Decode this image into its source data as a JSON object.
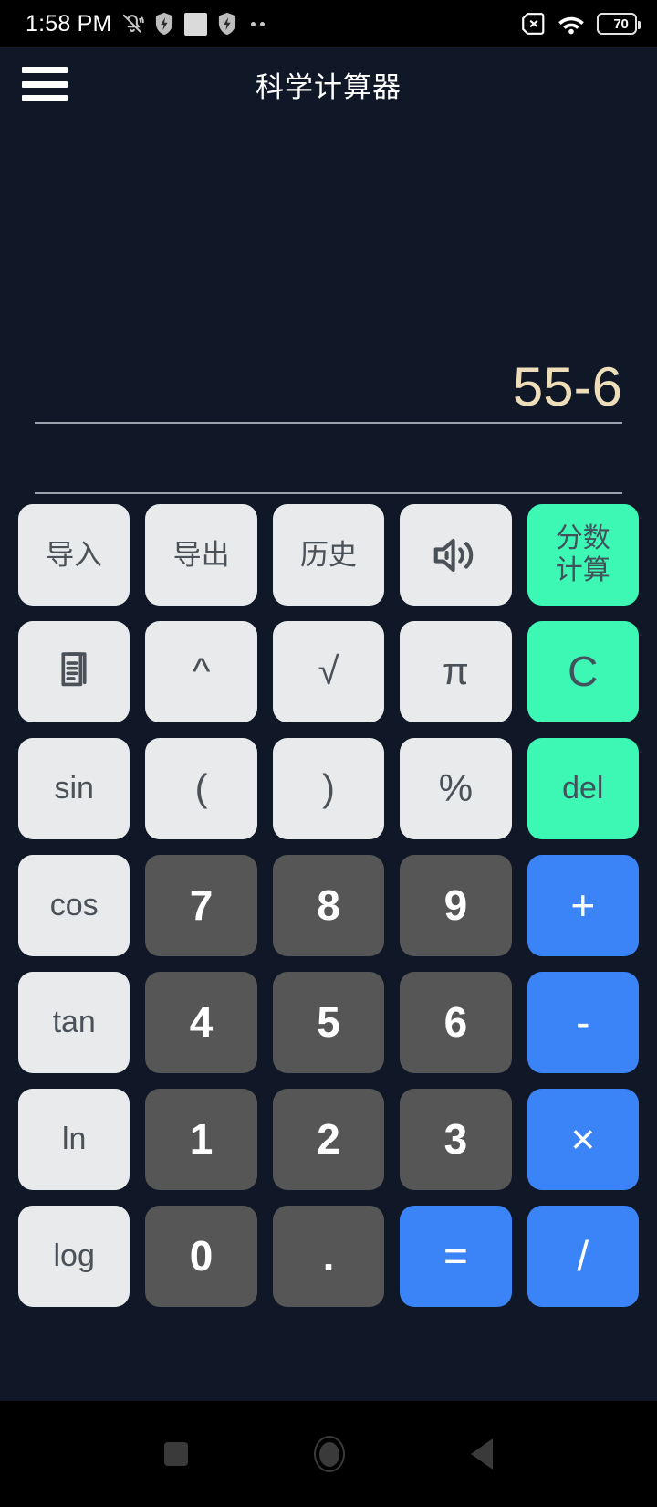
{
  "status_bar": {
    "time": "1:58 PM",
    "battery_percent": "70",
    "left_icons": [
      "bell-muted-icon",
      "shield-bolt-icon",
      "white-square-icon",
      "shield-bolt-icon",
      "two-dots-icon"
    ],
    "right_icons": [
      "sim-card-off-icon",
      "wifi-icon",
      "battery-icon"
    ]
  },
  "app_bar": {
    "menu_icon": "hamburger-menu-icon",
    "title": "科学计算器"
  },
  "display": {
    "expression": "55-6",
    "result": ""
  },
  "colors": {
    "background": "#101827",
    "status_bar": "#000000",
    "display_text": "#EEDDB9",
    "key_light": "#E8EAEC",
    "key_light_text": "#4A5158",
    "key_dark": "#565656",
    "key_dark_text": "#FFFFFF",
    "key_green": "#3DF7B5",
    "key_blue": "#3B84F7",
    "divider": "#9BA2AE"
  },
  "keypad": {
    "rows": [
      [
        {
          "label": "导入",
          "style": "light",
          "kind": "cjk",
          "name": "key-import"
        },
        {
          "label": "导出",
          "style": "light",
          "kind": "cjk",
          "name": "key-export"
        },
        {
          "label": "历史",
          "style": "light",
          "kind": "cjk",
          "name": "key-history"
        },
        {
          "label": "",
          "style": "light",
          "kind": "icon",
          "icon": "speaker-volume-icon",
          "name": "key-sound"
        },
        {
          "label": "分数\n计算",
          "style": "green",
          "kind": "cjk2",
          "name": "key-fraction-calc"
        }
      ],
      [
        {
          "label": "",
          "style": "light",
          "kind": "icon",
          "icon": "copy-documents-icon",
          "name": "key-copy"
        },
        {
          "label": "^",
          "style": "light",
          "kind": "sym",
          "name": "key-power"
        },
        {
          "label": "√",
          "style": "light",
          "kind": "sym",
          "name": "key-sqrt"
        },
        {
          "label": "π",
          "style": "light",
          "kind": "sym",
          "name": "key-pi"
        },
        {
          "label": "C",
          "style": "green",
          "kind": "c",
          "name": "key-clear"
        }
      ],
      [
        {
          "label": "sin",
          "style": "light",
          "kind": "fn",
          "name": "key-sin"
        },
        {
          "label": "(",
          "style": "light",
          "kind": "sym",
          "name": "key-paren-open"
        },
        {
          "label": ")",
          "style": "light",
          "kind": "sym",
          "name": "key-paren-close"
        },
        {
          "label": "%",
          "style": "light",
          "kind": "sym",
          "name": "key-percent"
        },
        {
          "label": "del",
          "style": "green",
          "kind": "del",
          "name": "key-delete"
        }
      ],
      [
        {
          "label": "cos",
          "style": "light",
          "kind": "fn",
          "name": "key-cos"
        },
        {
          "label": "7",
          "style": "dark",
          "kind": "num",
          "name": "key-7"
        },
        {
          "label": "8",
          "style": "dark",
          "kind": "num",
          "name": "key-8"
        },
        {
          "label": "9",
          "style": "dark",
          "kind": "num",
          "name": "key-9"
        },
        {
          "label": "+",
          "style": "blue",
          "kind": "op",
          "name": "key-plus"
        }
      ],
      [
        {
          "label": "tan",
          "style": "light",
          "kind": "fn",
          "name": "key-tan"
        },
        {
          "label": "4",
          "style": "dark",
          "kind": "num",
          "name": "key-4"
        },
        {
          "label": "5",
          "style": "dark",
          "kind": "num",
          "name": "key-5"
        },
        {
          "label": "6",
          "style": "dark",
          "kind": "num",
          "name": "key-6"
        },
        {
          "label": "-",
          "style": "blue",
          "kind": "op",
          "name": "key-minus"
        }
      ],
      [
        {
          "label": "ln",
          "style": "light",
          "kind": "fn",
          "name": "key-ln"
        },
        {
          "label": "1",
          "style": "dark",
          "kind": "num",
          "name": "key-1"
        },
        {
          "label": "2",
          "style": "dark",
          "kind": "num",
          "name": "key-2"
        },
        {
          "label": "3",
          "style": "dark",
          "kind": "num",
          "name": "key-3"
        },
        {
          "label": "×",
          "style": "blue",
          "kind": "op",
          "name": "key-multiply"
        }
      ],
      [
        {
          "label": "log",
          "style": "light",
          "kind": "fn",
          "name": "key-log"
        },
        {
          "label": "0",
          "style": "dark",
          "kind": "num",
          "name": "key-0"
        },
        {
          "label": ".",
          "style": "dark",
          "kind": "num",
          "name": "key-decimal"
        },
        {
          "label": "=",
          "style": "blue",
          "kind": "op",
          "name": "key-equals"
        },
        {
          "label": "/",
          "style": "blue",
          "kind": "op",
          "name": "key-divide"
        }
      ]
    ]
  },
  "nav_bar": {
    "recents_icon": "square-recents-icon",
    "home_icon": "circle-home-icon",
    "back_icon": "triangle-back-icon"
  }
}
